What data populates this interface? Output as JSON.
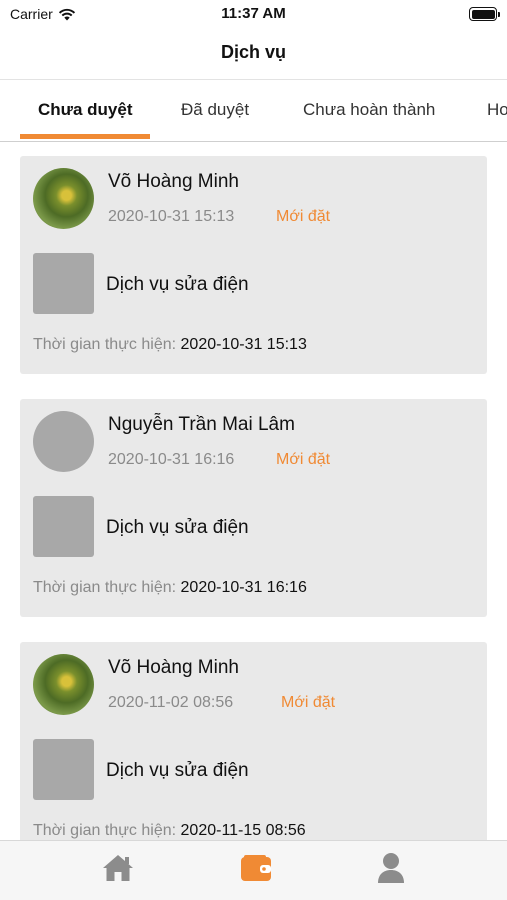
{
  "status_bar": {
    "carrier": "Carrier",
    "time": "11:37 AM"
  },
  "header": {
    "title": "Dịch vụ"
  },
  "tabs": [
    {
      "label": "Chưa duyệt",
      "active": true
    },
    {
      "label": "Đã duyệt",
      "active": false
    },
    {
      "label": "Chưa hoàn thành",
      "active": false
    },
    {
      "label": "Ho",
      "active": false
    }
  ],
  "orders": [
    {
      "name": "Võ Hoàng Minh",
      "date": "2020-10-31 15:13",
      "status": "Mới đặt",
      "service": "Dịch vụ sửa điện",
      "time_label": "Thời gian thực hiện:",
      "time_value": "2020-10-31 15:13",
      "avatar": "photo"
    },
    {
      "name": "Nguyễn Trần Mai Lâm",
      "date": "2020-10-31 16:16",
      "status": "Mới đặt",
      "service": "Dịch vụ sửa điện",
      "time_label": "Thời gian thực hiện:",
      "time_value": "2020-10-31 16:16",
      "avatar": "placeholder"
    },
    {
      "name": "Võ Hoàng Minh",
      "date": "2020-11-02 08:56",
      "status": "Mới đặt",
      "service": "Dịch vụ sửa điện",
      "time_label": "Thời gian thực hiện:",
      "time_value": "2020-11-15 08:56",
      "avatar": "photo"
    }
  ],
  "bottom_nav": [
    {
      "icon": "home-icon",
      "active": false
    },
    {
      "icon": "wallet-icon",
      "active": true
    },
    {
      "icon": "user-icon",
      "active": false
    }
  ],
  "colors": {
    "accent": "#f08a34",
    "card_bg": "#e9e9e9",
    "muted_text": "#8a8a8a",
    "icon_inactive": "#8c8c8c"
  }
}
